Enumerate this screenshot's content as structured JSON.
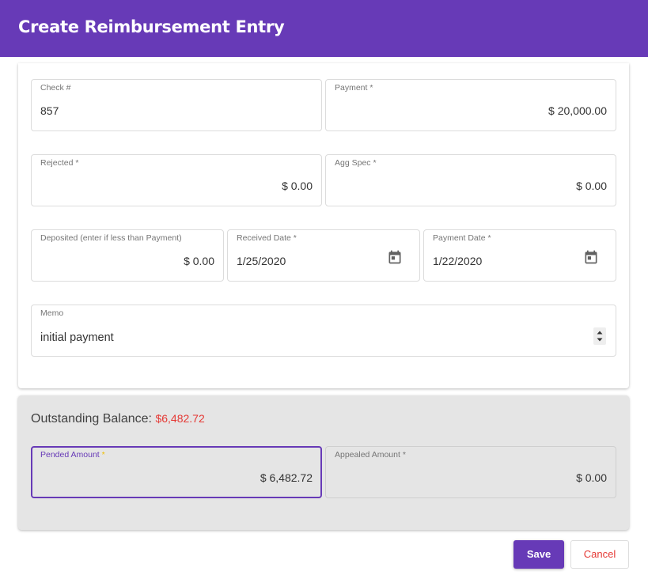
{
  "header": {
    "title": "Create Reimbursement Entry"
  },
  "form": {
    "check": {
      "label": "Check #",
      "value": "857"
    },
    "payment": {
      "label": "Payment",
      "required": "*",
      "value": "$ 20,000.00"
    },
    "rejected": {
      "label": "Rejected",
      "required": "*",
      "value": "$ 0.00"
    },
    "agg_spec": {
      "label": "Agg Spec",
      "required": "*",
      "value": "$ 0.00"
    },
    "deposited": {
      "label": "Deposited (enter if less than Payment)",
      "value": "$ 0.00"
    },
    "received_date": {
      "label": "Received Date",
      "required": "*",
      "value": "1/25/2020"
    },
    "payment_date": {
      "label": "Payment Date",
      "required": "*",
      "value": "1/22/2020"
    },
    "memo": {
      "label": "Memo",
      "value": "initial payment"
    }
  },
  "balance": {
    "label": "Outstanding Balance:",
    "value": "$6,482.72",
    "pended": {
      "label": "Pended Amount",
      "required": "*",
      "value": "$ 6,482.72"
    },
    "appealed": {
      "label": "Appealed Amount",
      "required": "*",
      "value": "$ 0.00"
    }
  },
  "actions": {
    "save": "Save",
    "cancel": "Cancel"
  },
  "colors": {
    "primary": "#673ab7",
    "danger": "#e53935",
    "panel_bg": "#e5e5e5"
  },
  "icons": {
    "date": "calendar-icon",
    "memo": "spinner-arrows-icon"
  }
}
